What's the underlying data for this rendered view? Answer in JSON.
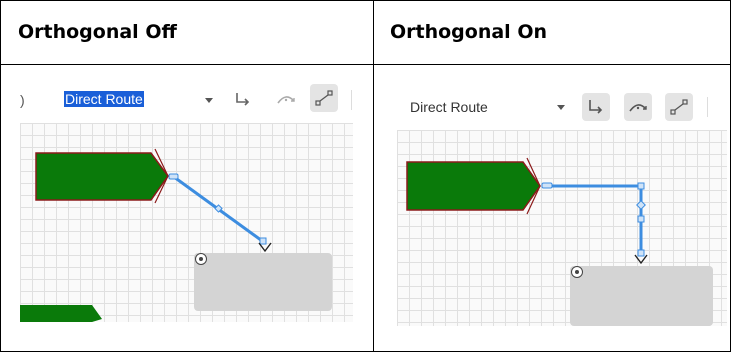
{
  "headers": {
    "left": "Orthogonal Off",
    "right": "Orthogonal On"
  },
  "left_panel": {
    "dropdown_value": "Direct Route",
    "dropdown_selected": true,
    "toolbar_icons": [
      "elbow-route-icon",
      "curved-route-icon",
      "straight-connector-icon"
    ],
    "active_icon": "straight-connector-icon"
  },
  "right_panel": {
    "dropdown_value": "Direct Route",
    "toolbar_icons": [
      "elbow-route-icon",
      "curved-route-icon",
      "straight-connector-icon"
    ]
  },
  "colors": {
    "shape_fill": "#0a7a0a",
    "shape_border": "#8b1a1a",
    "connector": "#3d8de0",
    "target_box": "#d4d4d4",
    "selection_highlight": "#1a5fd8"
  }
}
